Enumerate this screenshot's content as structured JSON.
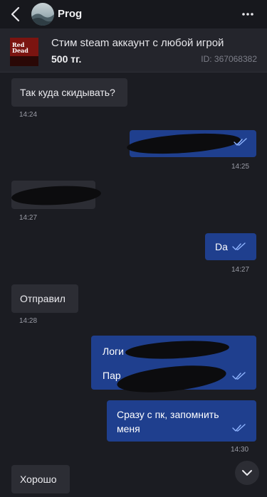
{
  "header": {
    "chat_name": "Prog"
  },
  "product": {
    "title": "Стим steam аккаунт с любой игрой",
    "price": "500 тг.",
    "id": "ID: 367068382",
    "thumb_text": "Red Dead"
  },
  "messages": [
    {
      "direction": "in",
      "text": "Так куда скидывать?",
      "time": "14:24"
    },
    {
      "direction": "out",
      "text": "",
      "time": "14:25",
      "redacted": true
    },
    {
      "direction": "in",
      "text": "",
      "time": "14:27",
      "redacted": true
    },
    {
      "direction": "out",
      "text": "Da",
      "time": "14:27"
    },
    {
      "direction": "in",
      "text": "Отправил",
      "time": "14:28"
    },
    {
      "direction": "out",
      "line1": "Логи",
      "line2": "Пар",
      "time": "",
      "redacted": true
    },
    {
      "direction": "out",
      "text": "Сразу с пк, запомнить меня",
      "line1": "Сразу с пк, запомнить",
      "line2": "меня",
      "time": "14:30"
    },
    {
      "direction": "in",
      "text": "Хорошо",
      "time": ""
    }
  ],
  "colors": {
    "background": "#1b1c22",
    "incoming_bubble": "#2c2d34",
    "outgoing_bubble": "#1f3f8e",
    "read_checks": "#8fb4ff"
  }
}
